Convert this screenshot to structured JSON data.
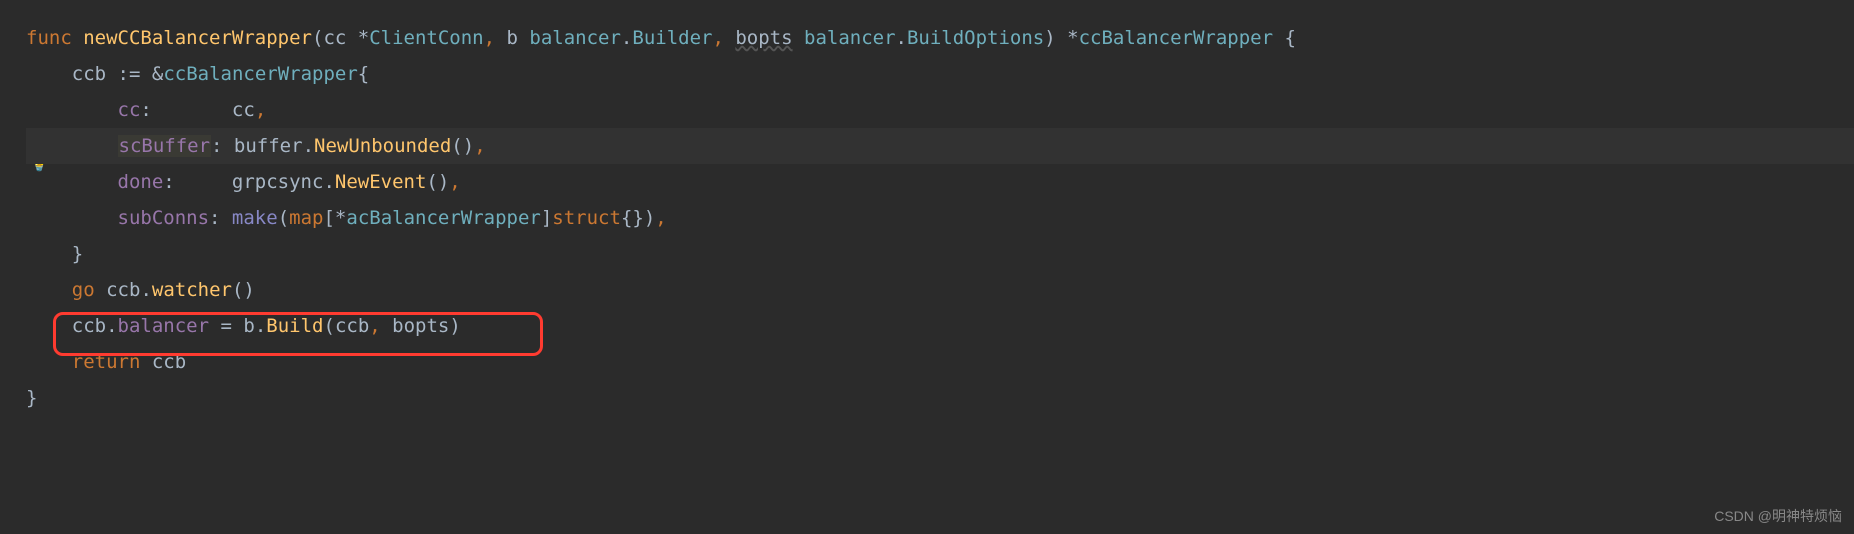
{
  "code": {
    "line1": {
      "kw_func": "func",
      "func_name": "newCCBalancerWrapper",
      "param1": "cc ",
      "star1": "*",
      "type1": "ClientConn",
      "comma1": ", ",
      "param2": "b ",
      "type2_pkg": "balancer",
      "dot1": ".",
      "type2_name": "Builder",
      "comma2": ", ",
      "param3": "bopts",
      "space3": " ",
      "type3_pkg": "balancer",
      "dot2": ".",
      "type3_name": "BuildOptions",
      "paren_close": ") ",
      "star2": "*",
      "return_type": "ccBalancerWrapper",
      "brace": " {"
    },
    "line2": {
      "indent": "    ",
      "ident": "ccb ",
      "op": ":= ",
      "amp": "&",
      "type": "ccBalancerWrapper",
      "brace": "{"
    },
    "line3": {
      "indent": "        ",
      "field": "cc",
      "colon": ":       ",
      "val": "cc",
      "comma": ","
    },
    "line4": {
      "indent": "        ",
      "field": "scBuffer",
      "colon": ": ",
      "pkg": "buffer",
      "dot": ".",
      "call": "NewUnbounded",
      "parens": "()",
      "comma": ","
    },
    "line5": {
      "indent": "        ",
      "field": "done",
      "colon": ":     ",
      "pkg": "grpcsync",
      "dot": ".",
      "call": "NewEvent",
      "parens": "()",
      "comma": ","
    },
    "line6": {
      "indent": "        ",
      "field": "subConns",
      "colon": ": ",
      "make": "make",
      "paren_open": "(",
      "map_kw": "map",
      "bracket_open": "[",
      "star": "*",
      "key_type": "acBalancerWrapper",
      "bracket_close": "]",
      "struct_kw": "struct",
      "braces": "{}",
      "paren_close": ")",
      "comma": ","
    },
    "line7": {
      "indent": "    ",
      "brace": "}"
    },
    "line8": {
      "indent": "    ",
      "go_kw": "go",
      "space": " ",
      "ident": "ccb",
      "dot": ".",
      "call": "watcher",
      "parens": "()"
    },
    "line9": {
      "indent": "    ",
      "ident1": "ccb",
      "dot1": ".",
      "field": "balancer",
      "eq": " = ",
      "ident2": "b",
      "dot2": ".",
      "call": "Build",
      "paren_open": "(",
      "arg1": "ccb",
      "comma": ", ",
      "arg2": "bopts",
      "paren_close": ")"
    },
    "line10": {
      "indent": "    ",
      "return_kw": "return",
      "space": " ",
      "ident": "ccb"
    },
    "line11": {
      "brace": "}"
    }
  },
  "watermark": "CSDN @明神特烦恼"
}
